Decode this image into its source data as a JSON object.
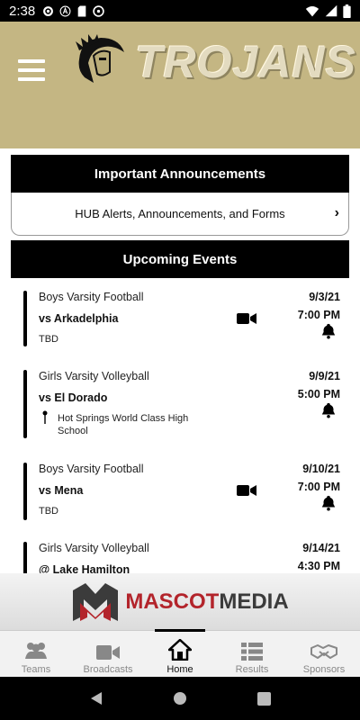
{
  "status_bar": {
    "time": "2:38",
    "icons": [
      "settings-icon",
      "nav-a-icon",
      "sd-card-icon",
      "vpn-icon"
    ],
    "right_icons": [
      "wifi-icon",
      "signal-icon",
      "battery-icon"
    ]
  },
  "header": {
    "brand_text": "TROJANS",
    "menu_icon": "hamburger-menu-icon",
    "logo_icon": "trojan-helmet-icon",
    "background_color": "#c4b683"
  },
  "announcements": {
    "title": "Important Announcements",
    "row_label": "HUB Alerts, Announcements, and Forms",
    "chevron": "›"
  },
  "events_section": {
    "title": "Upcoming Events",
    "events": [
      {
        "sport": "Boys Varsity Football",
        "opponent": "vs Arkadelphia",
        "location": "TBD",
        "date": "9/3/21",
        "time": "7:00 PM",
        "broadcast": true
      },
      {
        "sport": "Girls Varsity Volleyball",
        "opponent": "vs El Dorado",
        "location": "Hot Springs World Class High School",
        "date": "9/9/21",
        "time": "5:00 PM",
        "broadcast": false
      },
      {
        "sport": "Boys Varsity Football",
        "opponent": "vs Mena",
        "location": "TBD",
        "date": "9/10/21",
        "time": "7:00 PM",
        "broadcast": true
      },
      {
        "sport": "Girls Varsity Volleyball",
        "opponent": "@ Lake Hamilton",
        "location": "",
        "date": "9/14/21",
        "time": "4:30 PM",
        "broadcast": false
      }
    ]
  },
  "sponsor": {
    "word1": "MASCOT",
    "word2": "MEDIA",
    "logo_icon": "mascot-media-m-icon"
  },
  "tabbar": {
    "tabs": [
      {
        "label": "Teams",
        "icon": "teams-icon"
      },
      {
        "label": "Broadcasts",
        "icon": "video-camera-icon"
      },
      {
        "label": "Home",
        "icon": "home-icon",
        "active": true
      },
      {
        "label": "Results",
        "icon": "results-list-icon"
      },
      {
        "label": "Sponsors",
        "icon": "handshake-icon"
      }
    ]
  },
  "colors": {
    "accent_gold": "#c4b683",
    "mascot_red": "#b3242b",
    "bar_black": "#000000"
  }
}
